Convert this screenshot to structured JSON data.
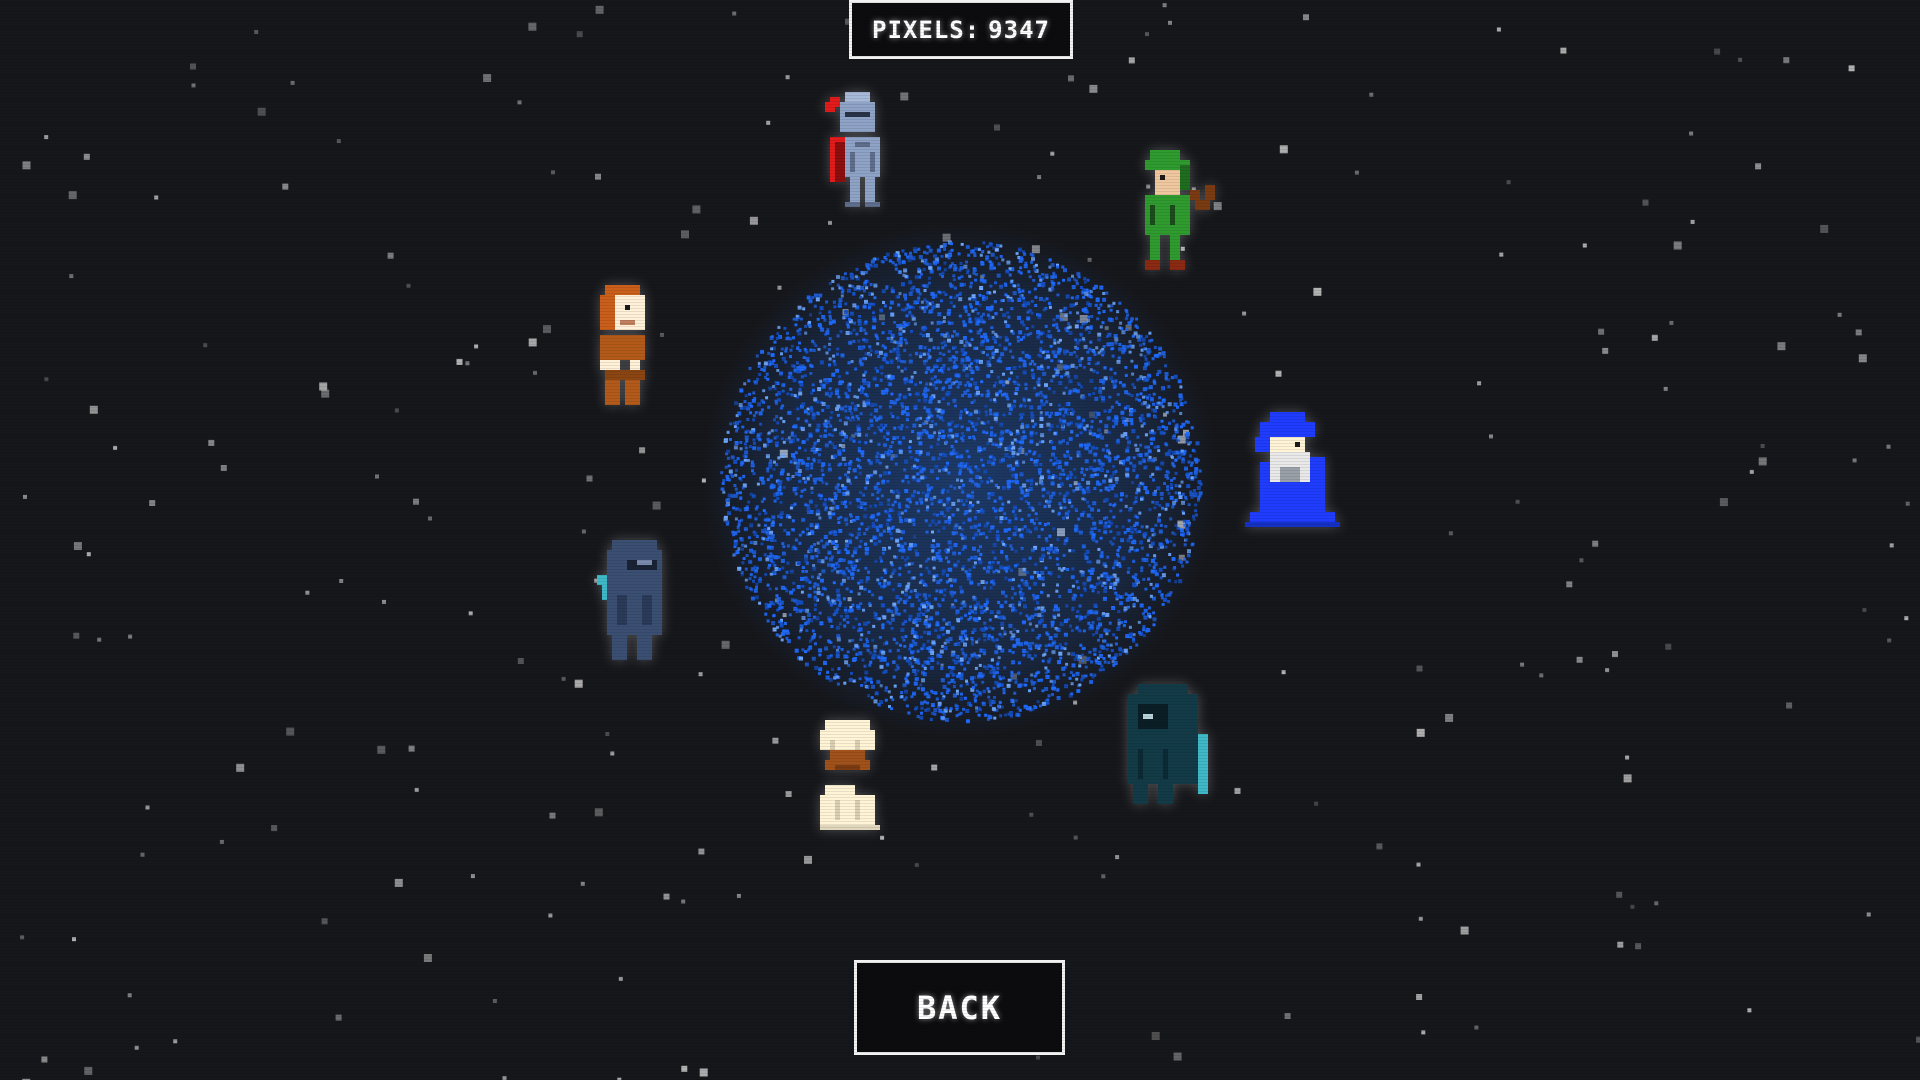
{
  "hud": {
    "pixels_label": "PIXELS:",
    "pixels_value": "9347"
  },
  "menu": {
    "back_label": "BACK"
  },
  "orb": {
    "color": "#1f6bff",
    "glow_color": "#2a7dff"
  },
  "heroes": [
    {
      "id": "knight",
      "name": "knight-hero",
      "colors": {
        "armor": "#8fa3c7",
        "plume": "#e21b1b"
      }
    },
    {
      "id": "archer",
      "name": "archer-hero",
      "colors": {
        "tunic": "#2f9b2f",
        "bow": "#7a3b12"
      }
    },
    {
      "id": "thief",
      "name": "thief-hero",
      "colors": {
        "hair": "#c95f1a",
        "body": "#b35a1a"
      }
    },
    {
      "id": "wizard",
      "name": "wizard-hero",
      "colors": {
        "robe": "#1f3cff",
        "beard": "#e9e9e9"
      }
    },
    {
      "id": "ninja",
      "name": "ninja-hero",
      "colors": {
        "suit": "#3b4f73",
        "blade": "#3fb8c8"
      }
    },
    {
      "id": "reaper",
      "name": "reaper-hero",
      "colors": {
        "cloak": "#123b47",
        "scythe": "#3fb8c8"
      }
    },
    {
      "id": "chef",
      "name": "chef-hero",
      "colors": {
        "hat": "#fff4d6",
        "beard": "#a0521a"
      }
    }
  ],
  "theme": {
    "background": "#16171b",
    "star_color": "#d0d0d0",
    "frame_color": "#f2f2f2"
  }
}
